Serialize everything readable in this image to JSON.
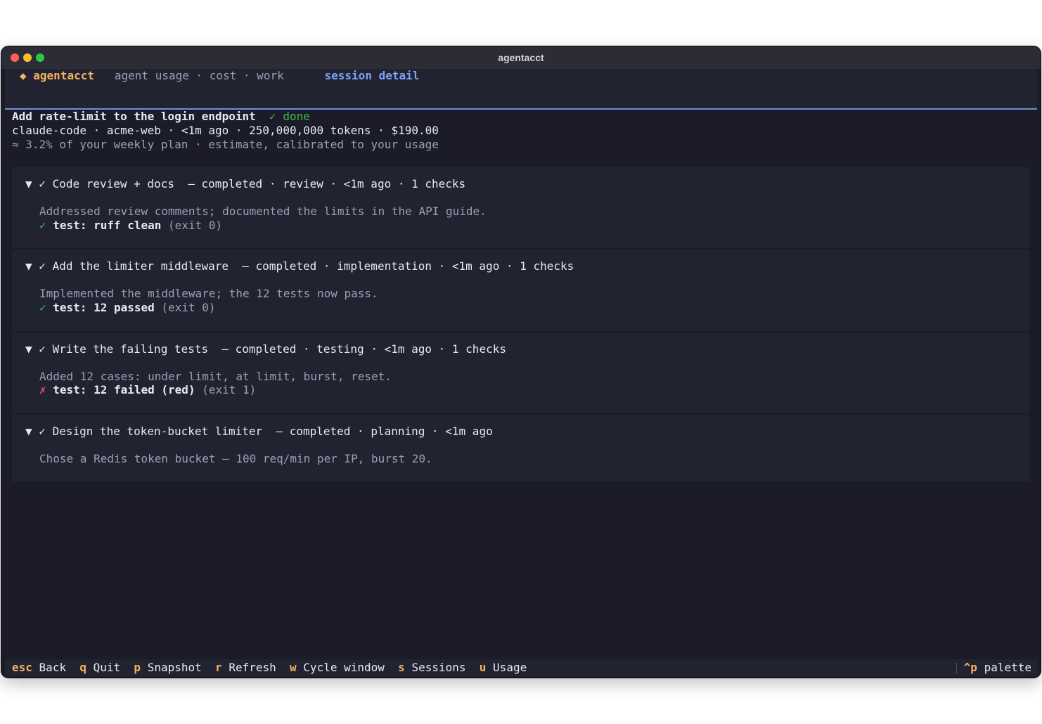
{
  "window": {
    "title": "agentacct"
  },
  "topbar": {
    "brand_icon": "◆",
    "brand": "agentacct",
    "subtitle": "agent usage · cost · work",
    "breadcrumb": "session detail"
  },
  "session": {
    "title": "Add rate-limit to the login endpoint",
    "status": "✓ done",
    "meta": "claude-code · acme-web · <1m ago · 250,000,000 tokens · $190.00",
    "estimate": "≈ 3.2% of your weekly plan · estimate, calibrated to your usage"
  },
  "steps": [
    {
      "toggle": "▼",
      "check": "✓",
      "title": "Code review + docs",
      "meta": "— completed · review · <1m ago · 1 checks",
      "summary": "Addressed review comments; documented the limits in the API guide.",
      "test_icon": "✓",
      "test_result": "pass",
      "test_label": "test: ruff clean",
      "test_exit": "(exit 0)"
    },
    {
      "toggle": "▼",
      "check": "✓",
      "title": "Add the limiter middleware",
      "meta": "— completed · implementation · <1m ago · 1 checks",
      "summary": "Implemented the middleware; the 12 tests now pass.",
      "test_icon": "✓",
      "test_result": "pass",
      "test_label": "test: 12 passed",
      "test_exit": "(exit 0)"
    },
    {
      "toggle": "▼",
      "check": "✓",
      "title": "Write the failing tests",
      "meta": "— completed · testing · <1m ago · 1 checks",
      "summary": "Added 12 cases: under limit, at limit, burst, reset.",
      "test_icon": "✗",
      "test_result": "fail",
      "test_label": "test: 12 failed (red)",
      "test_exit": "(exit 1)"
    },
    {
      "toggle": "▼",
      "check": "✓",
      "title": "Design the token-bucket limiter",
      "meta": "— completed · planning · <1m ago",
      "summary": "Chose a Redis token bucket — 100 req/min per IP, burst 20."
    }
  ],
  "footer": {
    "bindings": [
      {
        "key": "esc",
        "label": "Back"
      },
      {
        "key": "q",
        "label": "Quit"
      },
      {
        "key": "p",
        "label": "Snapshot"
      },
      {
        "key": "r",
        "label": "Refresh"
      },
      {
        "key": "w",
        "label": "Cycle window"
      },
      {
        "key": "s",
        "label": "Sessions"
      },
      {
        "key": "u",
        "label": "Usage"
      }
    ],
    "palette_key": "^p",
    "palette_label": "palette"
  },
  "colors": {
    "accent": "#f4b35e",
    "link": "#7aa2f7",
    "success": "#3fb950",
    "failure": "#f05a5a",
    "background": "#1b1c27",
    "panel": "#222331"
  }
}
